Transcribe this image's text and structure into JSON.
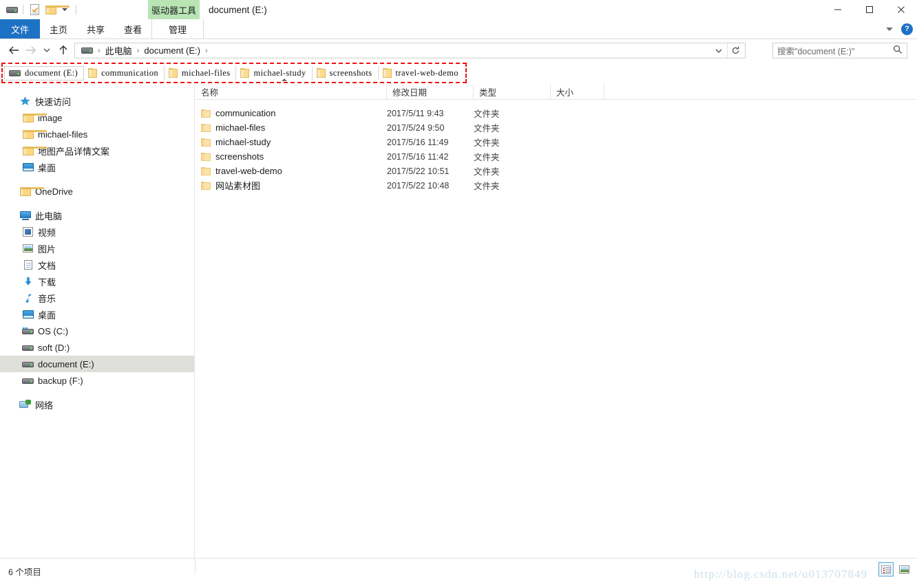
{
  "window": {
    "title": "document (E:)",
    "contextual_tool": "驱动器工具",
    "minimize": "—",
    "maximize": "□",
    "close": "✕",
    "help": "?"
  },
  "quick_access_toolbar": {
    "items": [
      {
        "icon": "drive-icon",
        "label": ""
      },
      {
        "icon": "properties-icon",
        "label": ""
      },
      {
        "icon": "new-folder-icon",
        "label": ""
      },
      {
        "icon": "customize-chevron-icon",
        "label": ""
      }
    ]
  },
  "ribbon": {
    "tabs": [
      {
        "id": "file",
        "label": "文件",
        "active": true
      },
      {
        "id": "home",
        "label": "主页",
        "active": false
      },
      {
        "id": "share",
        "label": "共享",
        "active": false
      },
      {
        "id": "view",
        "label": "查看",
        "active": false
      },
      {
        "id": "manage",
        "label": "管理",
        "active": false,
        "contextual": true
      }
    ],
    "collapse_label": "",
    "accent_blue": "#1e72c4",
    "contextual_green": "#b9e5b4"
  },
  "address_bar": {
    "back_tooltip": "后退",
    "forward_tooltip": "前进",
    "recent_tooltip": "最近浏览的位置",
    "up_tooltip": "上移一级",
    "breadcrumbs": [
      {
        "label": "此电脑",
        "icon": "drive-icon"
      },
      {
        "label": "document (E:)",
        "icon": ""
      }
    ],
    "separator": "›",
    "refresh_label": "↻"
  },
  "search": {
    "placeholder": "搜索\"document (E:)\"",
    "icon": "search-icon"
  },
  "quick_links_bar": {
    "highlight_color": "#ee1111",
    "items": [
      {
        "label": "document (E:)",
        "icon": "drive-icon",
        "current": true
      },
      {
        "label": "communication",
        "icon": "folder-icon",
        "current": false
      },
      {
        "label": "michael-files",
        "icon": "folder-icon",
        "current": false
      },
      {
        "label": "michael-study",
        "icon": "folder-icon",
        "current": false
      },
      {
        "label": "screenshots",
        "icon": "folder-icon",
        "current": false
      },
      {
        "label": "travel-web-demo",
        "icon": "folder-icon",
        "current": false
      }
    ]
  },
  "navigation_pane": {
    "items": [
      {
        "label": "快速访问",
        "icon": "star-icon",
        "indent": 0,
        "selected": false
      },
      {
        "label": "image",
        "icon": "folder-icon",
        "indent": 1,
        "selected": false
      },
      {
        "label": "michael-files",
        "icon": "folder-icon",
        "indent": 1,
        "selected": false
      },
      {
        "label": "地图产品详情文案",
        "icon": "folder-icon",
        "indent": 1,
        "selected": false
      },
      {
        "label": "桌面",
        "icon": "desktop-icon",
        "indent": 1,
        "selected": false
      },
      {
        "label": "OneDrive",
        "icon": "onedrive-folder-icon",
        "indent": 0,
        "selected": false
      },
      {
        "label": "此电脑",
        "icon": "this-pc-icon",
        "indent": 0,
        "selected": false
      },
      {
        "label": "视频",
        "icon": "videos-icon",
        "indent": 1,
        "selected": false
      },
      {
        "label": "图片",
        "icon": "pictures-icon",
        "indent": 1,
        "selected": false
      },
      {
        "label": "文档",
        "icon": "documents-icon",
        "indent": 1,
        "selected": false
      },
      {
        "label": "下载",
        "icon": "downloads-icon",
        "indent": 1,
        "selected": false
      },
      {
        "label": "音乐",
        "icon": "music-icon",
        "indent": 1,
        "selected": false
      },
      {
        "label": "桌面",
        "icon": "desktop-icon",
        "indent": 1,
        "selected": false
      },
      {
        "label": "OS (C:)",
        "icon": "os-drive-icon",
        "indent": 1,
        "selected": false
      },
      {
        "label": "soft (D:)",
        "icon": "drive-icon",
        "indent": 1,
        "selected": false
      },
      {
        "label": "document (E:)",
        "icon": "drive-icon",
        "indent": 1,
        "selected": true
      },
      {
        "label": "backup (F:)",
        "icon": "drive-icon",
        "indent": 1,
        "selected": false
      },
      {
        "label": "网络",
        "icon": "network-icon",
        "indent": 0,
        "selected": false
      }
    ]
  },
  "file_list": {
    "columns": [
      {
        "key": "name",
        "label": "名称",
        "sorted": "asc"
      },
      {
        "key": "date",
        "label": "修改日期",
        "sorted": ""
      },
      {
        "key": "type",
        "label": "类型",
        "sorted": ""
      },
      {
        "key": "size",
        "label": "大小",
        "sorted": ""
      }
    ],
    "rows": [
      {
        "name": "communication",
        "date": "2017/5/11 9:43",
        "type": "文件夹",
        "size": "",
        "icon": "folder-icon"
      },
      {
        "name": "michael-files",
        "date": "2017/5/24 9:50",
        "type": "文件夹",
        "size": "",
        "icon": "folder-icon"
      },
      {
        "name": "michael-study",
        "date": "2017/5/16 11:49",
        "type": "文件夹",
        "size": "",
        "icon": "folder-icon"
      },
      {
        "name": "screenshots",
        "date": "2017/5/16 11:42",
        "type": "文件夹",
        "size": "",
        "icon": "folder-icon"
      },
      {
        "name": "travel-web-demo",
        "date": "2017/5/22 10:51",
        "type": "文件夹",
        "size": "",
        "icon": "folder-icon"
      },
      {
        "name": "网站素材图",
        "date": "2017/5/22 10:48",
        "type": "文件夹",
        "size": "",
        "icon": "folder-icon"
      }
    ]
  },
  "status_bar": {
    "item_count": "6 个项目",
    "watermark": "http://blog.csdn.net/u013707849",
    "views": [
      {
        "id": "details",
        "icon": "details-view-icon",
        "active": true
      },
      {
        "id": "thumbnails",
        "icon": "thumbnail-view-icon",
        "active": false
      }
    ]
  }
}
